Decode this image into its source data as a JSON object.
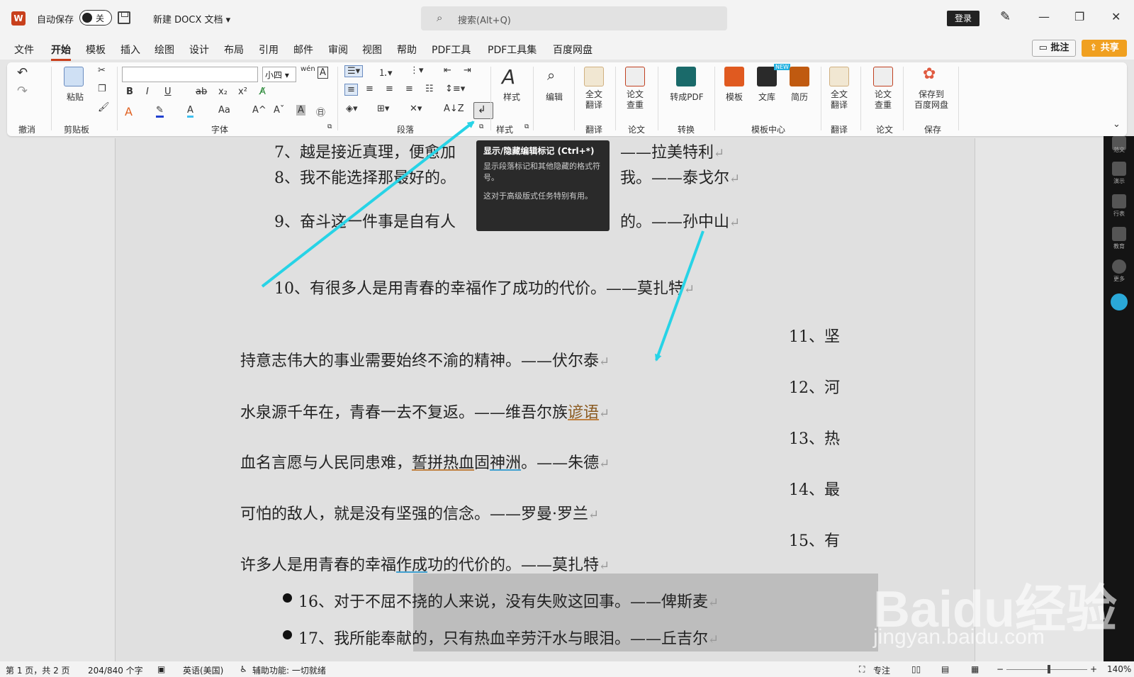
{
  "titlebar": {
    "app_logo": "W",
    "autosave_label": "自动保存",
    "autosave_toggle": "关",
    "doc_title": "新建 DOCX 文档",
    "search_placeholder": "搜索(Alt+Q)",
    "login_label": "登录"
  },
  "menu": {
    "items": [
      "文件",
      "开始",
      "模板",
      "插入",
      "绘图",
      "设计",
      "布局",
      "引用",
      "邮件",
      "审阅",
      "视图",
      "帮助",
      "PDF工具",
      "PDF工具集",
      "百度网盘"
    ],
    "active": "开始",
    "comment_label": "批注",
    "share_label": "共享"
  },
  "ribbon": {
    "groups": {
      "undo": "撤消",
      "clipboard": "剪贴板",
      "font": "字体",
      "paragraph": "段落",
      "style": "样式",
      "translate": "翻译",
      "thesis": "论文",
      "convert": "转换",
      "template_center": "模板中心",
      "translate2": "翻译",
      "thesis2": "论文",
      "save": "保存"
    },
    "buttons": {
      "paste": "粘贴",
      "font_size": "小四",
      "style": "样式",
      "edit": "编辑",
      "full_translate": "全文\n翻译",
      "thesis_check": "论文\n查重",
      "to_pdf": "转成PDF",
      "template": "模板",
      "library": "文库",
      "resume": "简历",
      "full_translate2": "全文\n翻译",
      "thesis_check2": "论文\n查重",
      "save_to_baidu": "保存到\n百度网盘",
      "new_badge": "NEW"
    }
  },
  "tooltip": {
    "title": "显示/隐藏编辑标记 (Ctrl+*)",
    "body1": "显示段落标记和其他隐藏的格式符号。",
    "body2": "这对于高级版式任务特别有用。"
  },
  "document": {
    "l7": "7、越是接近真理，便愈加",
    "l7b": "——拉美特利",
    "l8": "8、我不能选择那最好的。",
    "l8b": "我。——泰戈尔",
    "l9": "9、奋斗这一件事是自有人",
    "l9b": "的。——孙中山",
    "l10": "10、有很多人是用青春的幸福作了成功的代价。——莫扎特",
    "l11": "11、坚",
    "p11": "持意志伟大的事业需要始终不渝的精神。——伏尔泰",
    "l12": "12、河",
    "p12a": "水泉源千年在，青春一去不复返。——维吾尔族",
    "p12b": "谚语",
    "l13": "13、热",
    "p13a": "血名言愿与人民同患难，",
    "p13b": "誓拼热血",
    "p13c": "固",
    "p13d": "神洲",
    "p13e": "。——朱德",
    "l14": "14、最",
    "p14": "可怕的敌人，就是没有坚强的信念。——罗曼·罗兰",
    "l15": "15、有",
    "p15a": "许多人是用青春的幸福",
    "p15b": "作成",
    "p15c": "功的代价的。——莫扎特",
    "l16": "16、对于不屈不挠的人来说，没有失败这回事。——俾斯麦",
    "l17": "17、我所能奉献的，只有热血辛劳汗水与眼泪。——丘吉尔",
    "para_mark": "↵"
  },
  "sidebar": {
    "labels": [
      "范文",
      "演示",
      "行表",
      "教育",
      "更多"
    ]
  },
  "statusbar": {
    "page": "第 1 页，共 2 页",
    "words": "204/840 个字",
    "language": "英语(美国)",
    "accessibility": "辅助功能: 一切就绪",
    "focus": "专注",
    "zoom": "140%"
  },
  "watermark": {
    "big": "Baidu经验",
    "small": "jingyan.baidu.com"
  },
  "colors": {
    "accent": "#c8401c",
    "share": "#f0a020",
    "arrow": "#27d3e6",
    "tooltip_bg": "#2a2a2a"
  }
}
